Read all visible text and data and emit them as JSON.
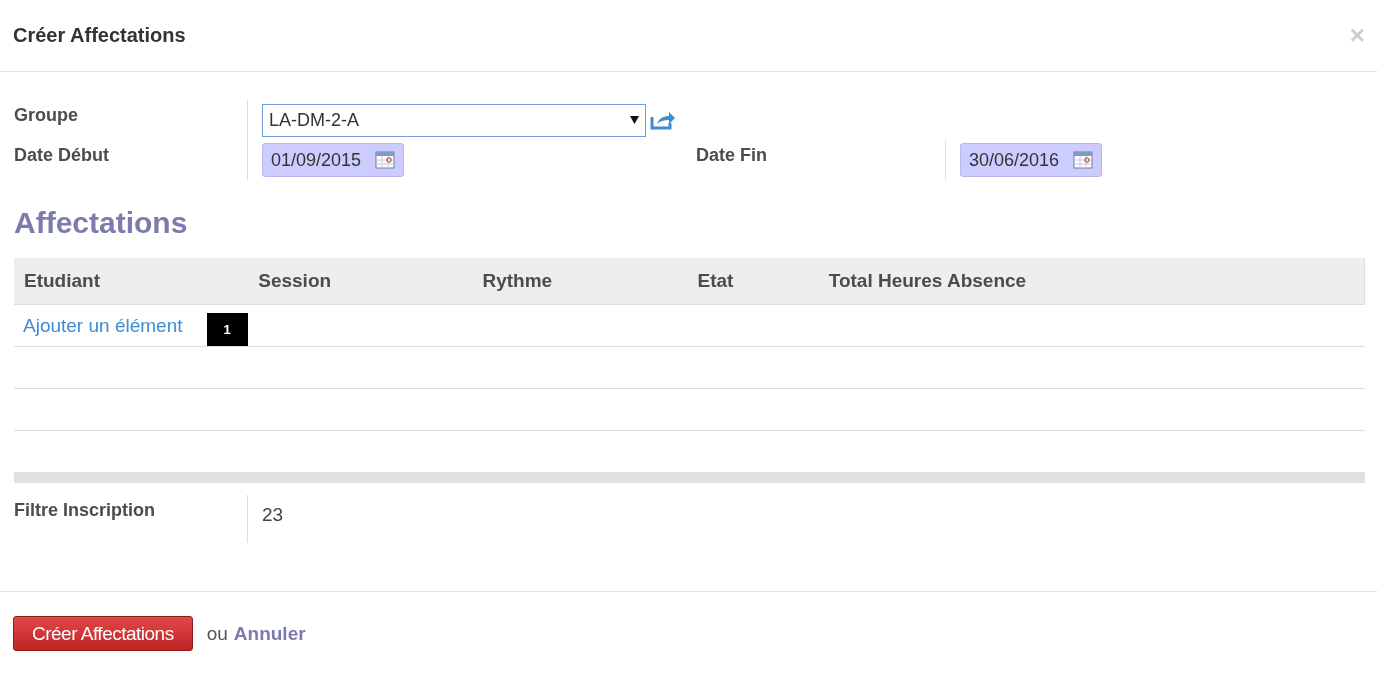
{
  "dialog": {
    "title": "Créer Affectations",
    "close": "×"
  },
  "form": {
    "groupe": {
      "label": "Groupe",
      "value": "LA-DM-2-A"
    },
    "date_debut": {
      "label": "Date Début",
      "value": "01/09/2015"
    },
    "date_fin": {
      "label": "Date Fin",
      "value": "30/06/2016"
    }
  },
  "section_title": "Affectations",
  "table": {
    "columns": [
      "Etudiant",
      "Session",
      "Rythme",
      "Etat",
      "Total Heures Absence"
    ],
    "add_link": "Ajouter un élément",
    "marker": "1"
  },
  "filtre": {
    "label": "Filtre Inscription",
    "value": "23"
  },
  "footer": {
    "primary": "Créer Affectations",
    "separator": "ou",
    "cancel": "Annuler"
  }
}
